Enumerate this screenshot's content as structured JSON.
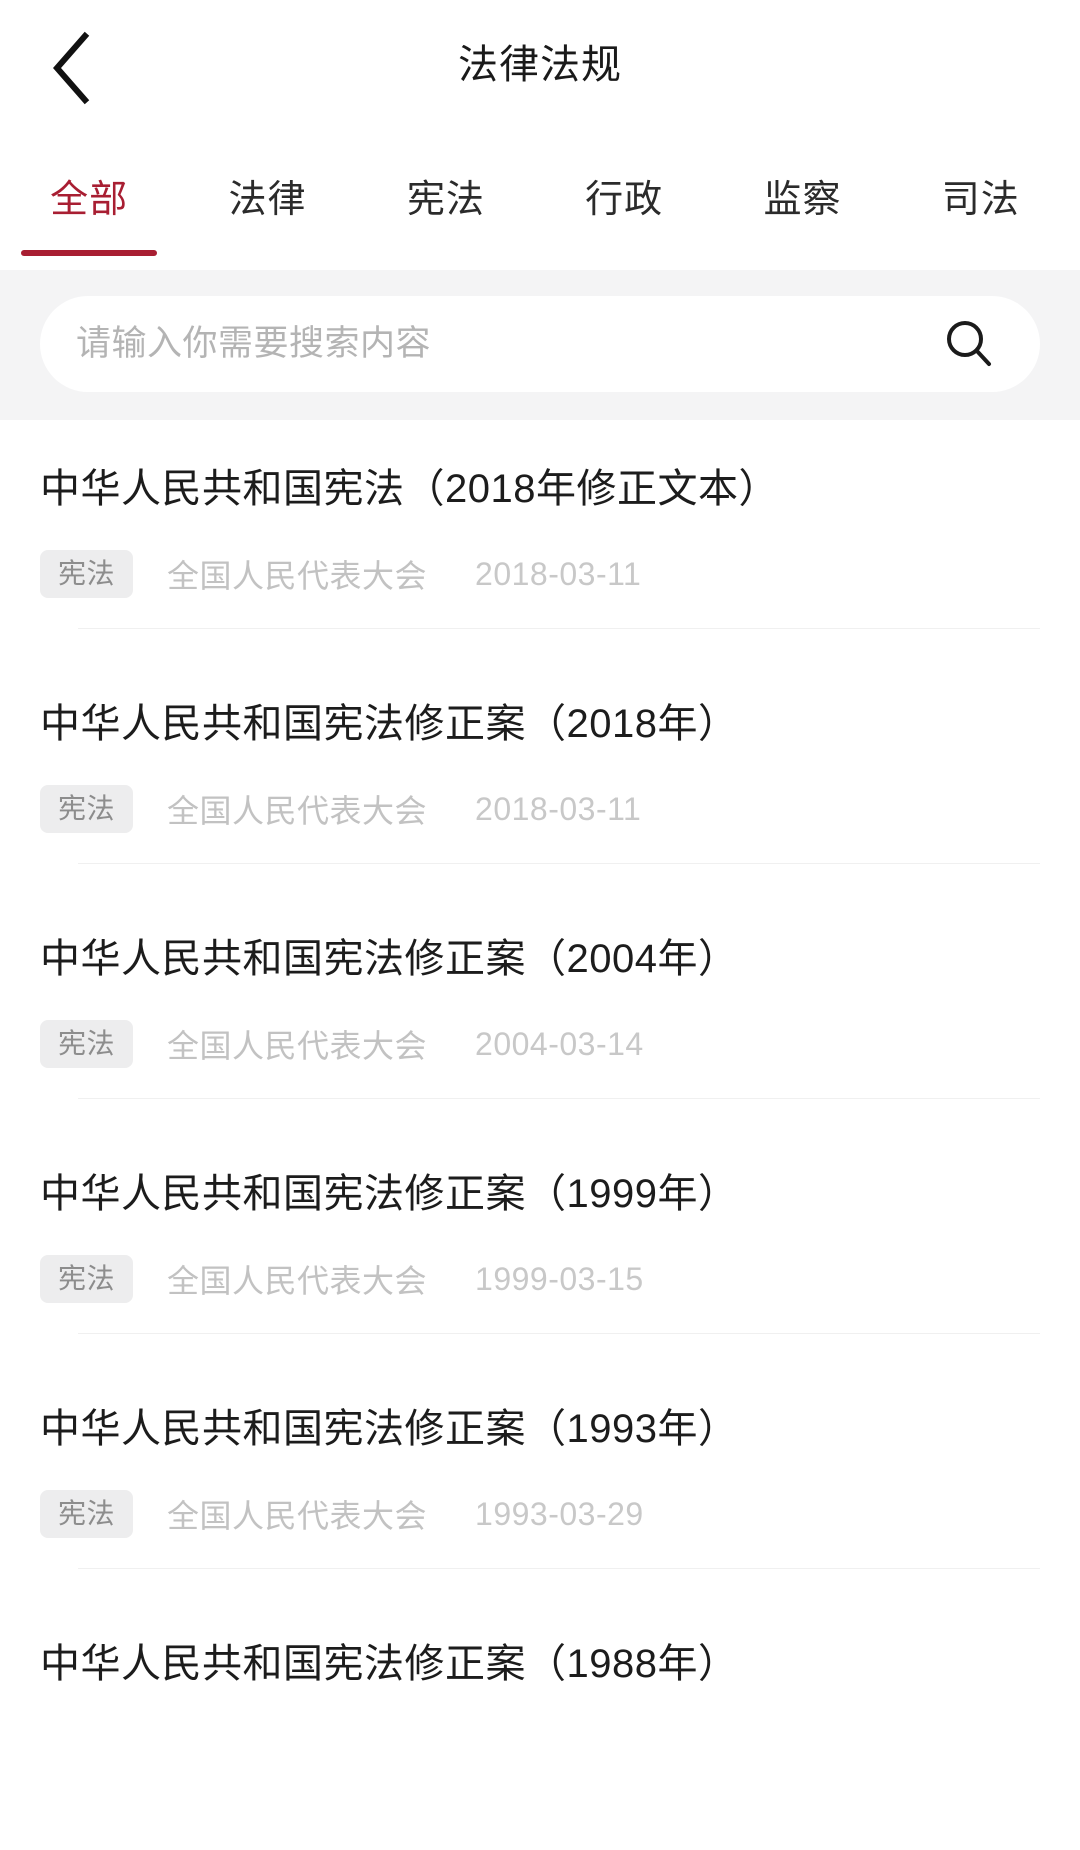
{
  "header": {
    "back_icon": "chevron-left-icon",
    "title": "法律法规"
  },
  "tabs": [
    {
      "label": "全部",
      "active": true
    },
    {
      "label": "法律",
      "active": false
    },
    {
      "label": "宪法",
      "active": false
    },
    {
      "label": "行政",
      "active": false
    },
    {
      "label": "监察",
      "active": false
    },
    {
      "label": "司法",
      "active": false
    }
  ],
  "search": {
    "placeholder": "请输入你需要搜索内容",
    "value": "",
    "icon": "search-icon"
  },
  "colors": {
    "accent": "#A81E32",
    "band_background": "#F4F4F5",
    "tag_background": "#EDEDEE",
    "muted_text": "#C2C2C2",
    "title_text": "#1C1C1C",
    "divider": "#F0F0F0"
  },
  "list": [
    {
      "title": "中华人民共和国宪法（2018年修正文本）",
      "tag": "宪法",
      "agency": "全国人民代表大会",
      "date": "2018-03-11"
    },
    {
      "title": "中华人民共和国宪法修正案（2018年）",
      "tag": "宪法",
      "agency": "全国人民代表大会",
      "date": "2018-03-11"
    },
    {
      "title": "中华人民共和国宪法修正案（2004年）",
      "tag": "宪法",
      "agency": "全国人民代表大会",
      "date": "2004-03-14"
    },
    {
      "title": "中华人民共和国宪法修正案（1999年）",
      "tag": "宪法",
      "agency": "全国人民代表大会",
      "date": "1999-03-15"
    },
    {
      "title": "中华人民共和国宪法修正案（1993年）",
      "tag": "宪法",
      "agency": "全国人民代表大会",
      "date": "1993-03-29"
    },
    {
      "title": "中华人民共和国宪法修正案（1988年）",
      "tag": "",
      "agency": "",
      "date": ""
    }
  ]
}
